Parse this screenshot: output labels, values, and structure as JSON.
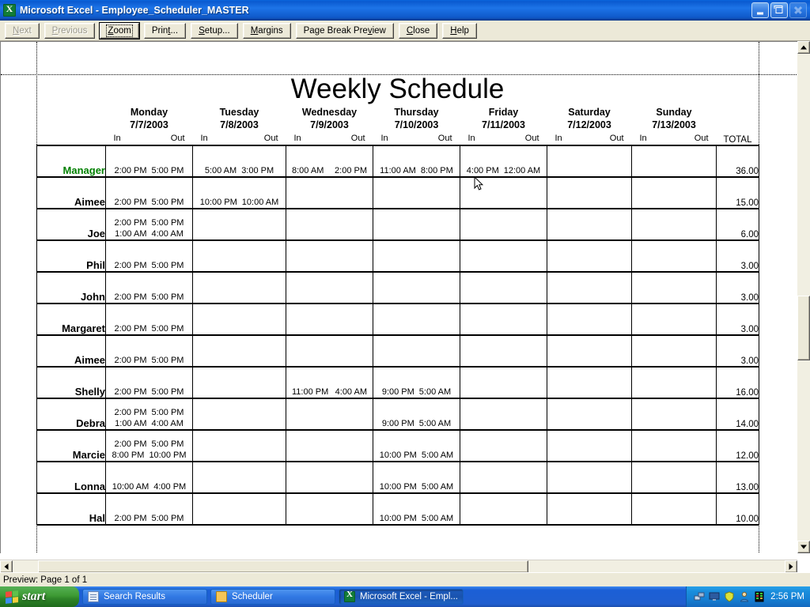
{
  "window": {
    "title": "Microsoft Excel - Employee_Scheduler_MASTER",
    "app_icon": "excel-icon",
    "minimize_label": "Minimize",
    "restore_label": "Restore",
    "close_label": "Close"
  },
  "toolbar": {
    "buttons": [
      {
        "label": "Next",
        "accel": "N",
        "disabled": true,
        "default": false
      },
      {
        "label": "Previous",
        "accel": "P",
        "disabled": true,
        "default": false
      },
      {
        "label": "Zoom",
        "accel": "Z",
        "disabled": false,
        "default": true
      },
      {
        "label": "Print...",
        "accel": "t",
        "disabled": false,
        "default": false
      },
      {
        "label": "Setup...",
        "accel": "S",
        "disabled": false,
        "default": false
      },
      {
        "label": "Margins",
        "accel": "M",
        "disabled": false,
        "default": false
      },
      {
        "label": "Page Break Preview",
        "accel": "v",
        "disabled": false,
        "default": false
      },
      {
        "label": "Close",
        "accel": "C",
        "disabled": false,
        "default": false
      },
      {
        "label": "Help",
        "accel": "H",
        "disabled": false,
        "default": false
      }
    ]
  },
  "sheet": {
    "title": "Weekly Schedule",
    "total_header": "TOTAL",
    "in_label": "In",
    "out_label": "Out",
    "manager_color": "#008000",
    "days": [
      {
        "name": "Monday",
        "date": "7/7/2003"
      },
      {
        "name": "Tuesday",
        "date": "7/8/2003"
      },
      {
        "name": "Wednesday",
        "date": "7/9/2003"
      },
      {
        "name": "Thursday",
        "date": "7/10/2003"
      },
      {
        "name": "Friday",
        "date": "7/11/2003"
      },
      {
        "name": "Saturday",
        "date": "7/12/2003"
      },
      {
        "name": "Sunday",
        "date": "7/13/2003"
      }
    ],
    "rows": [
      {
        "name": "Manager",
        "is_manager": true,
        "total": "36.00",
        "cells": [
          [
            {
              "in": "2:00 PM",
              "out": "5:00 PM"
            }
          ],
          [
            {
              "in": "5:00 AM",
              "out": "3:00 PM"
            }
          ],
          [
            {
              "in": "8:00 AM",
              "out": "2:00 PM",
              "wide": true
            }
          ],
          [
            {
              "in": "11:00 AM",
              "out": "8:00 PM"
            }
          ],
          [
            {
              "in": "4:00 PM",
              "out": "12:00 AM"
            }
          ],
          [],
          []
        ]
      },
      {
        "name": "Aimee",
        "is_manager": false,
        "total": "15.00",
        "cells": [
          [
            {
              "in": "2:00 PM",
              "out": "5:00 PM"
            }
          ],
          [
            {
              "in": "10:00 PM",
              "out": "10:00 AM"
            }
          ],
          [],
          [],
          [],
          [],
          []
        ]
      },
      {
        "name": "Joe",
        "is_manager": false,
        "total": "6.00",
        "cells": [
          [
            {
              "in": "2:00 PM",
              "out": "5:00 PM"
            },
            {
              "in": "1:00 AM",
              "out": "4:00 AM"
            }
          ],
          [],
          [],
          [],
          [],
          [],
          []
        ]
      },
      {
        "name": "Phil",
        "is_manager": false,
        "total": "3.00",
        "cells": [
          [
            {
              "in": "2:00 PM",
              "out": "5:00 PM"
            }
          ],
          [],
          [],
          [],
          [],
          [],
          []
        ]
      },
      {
        "name": "John",
        "is_manager": false,
        "total": "3.00",
        "cells": [
          [
            {
              "in": "2:00 PM",
              "out": "5:00 PM"
            }
          ],
          [],
          [],
          [],
          [],
          [],
          []
        ]
      },
      {
        "name": "Margaret",
        "is_manager": false,
        "total": "3.00",
        "cells": [
          [
            {
              "in": "2:00 PM",
              "out": "5:00 PM"
            }
          ],
          [],
          [],
          [],
          [],
          [],
          []
        ]
      },
      {
        "name": "Aimee",
        "is_manager": false,
        "total": "3.00",
        "cells": [
          [
            {
              "in": "2:00 PM",
              "out": "5:00 PM"
            }
          ],
          [],
          [],
          [],
          [],
          [],
          []
        ]
      },
      {
        "name": "Shelly",
        "is_manager": false,
        "total": "16.00",
        "cells": [
          [
            {
              "in": "2:00 PM",
              "out": "5:00 PM"
            }
          ],
          [],
          [
            {
              "in": "11:00 PM",
              "out": "4:00 AM",
              "wide": true
            }
          ],
          [
            {
              "in": "9:00 PM",
              "out": "5:00 AM"
            }
          ],
          [],
          [],
          []
        ]
      },
      {
        "name": "Debra",
        "is_manager": false,
        "total": "14.00",
        "cells": [
          [
            {
              "in": "2:00 PM",
              "out": "5:00 PM"
            },
            {
              "in": "1:00 AM",
              "out": "4:00 AM"
            }
          ],
          [],
          [],
          [
            {
              "in": "9:00 PM",
              "out": "5:00 AM"
            }
          ],
          [],
          [],
          []
        ]
      },
      {
        "name": "Marcie",
        "is_manager": false,
        "total": "12.00",
        "cells": [
          [
            {
              "in": "2:00 PM",
              "out": "5:00 PM"
            },
            {
              "in": "8:00 PM",
              "out": "10:00 PM"
            }
          ],
          [],
          [],
          [
            {
              "in": "10:00 PM",
              "out": "5:00 AM"
            }
          ],
          [],
          [],
          []
        ]
      },
      {
        "name": "Lonna",
        "is_manager": false,
        "total": "13.00",
        "cells": [
          [
            {
              "in": "10:00 AM",
              "out": "4:00 PM"
            }
          ],
          [],
          [],
          [
            {
              "in": "10:00 PM",
              "out": "5:00 AM"
            }
          ],
          [],
          [],
          []
        ]
      },
      {
        "name": "Hal",
        "is_manager": false,
        "total": "10.00",
        "cells": [
          [
            {
              "in": "2:00 PM",
              "out": "5:00 PM"
            }
          ],
          [],
          [],
          [
            {
              "in": "10:00 PM",
              "out": "5:00 AM"
            }
          ],
          [],
          [],
          []
        ]
      }
    ]
  },
  "statusbar": {
    "text": "Preview: Page 1 of 1"
  },
  "taskbar": {
    "start_label": "start",
    "tasks": [
      {
        "label": "Search Results",
        "icon": "document-icon",
        "active": false
      },
      {
        "label": "Scheduler",
        "icon": "folder-icon",
        "active": false
      },
      {
        "label": "Microsoft Excel - Empl...",
        "icon": "excel-icon",
        "active": true
      }
    ],
    "tray_icons": [
      "network-icon",
      "display-icon",
      "shield-icon",
      "user-icon",
      "memory-icon"
    ],
    "clock": "2:56 PM"
  }
}
